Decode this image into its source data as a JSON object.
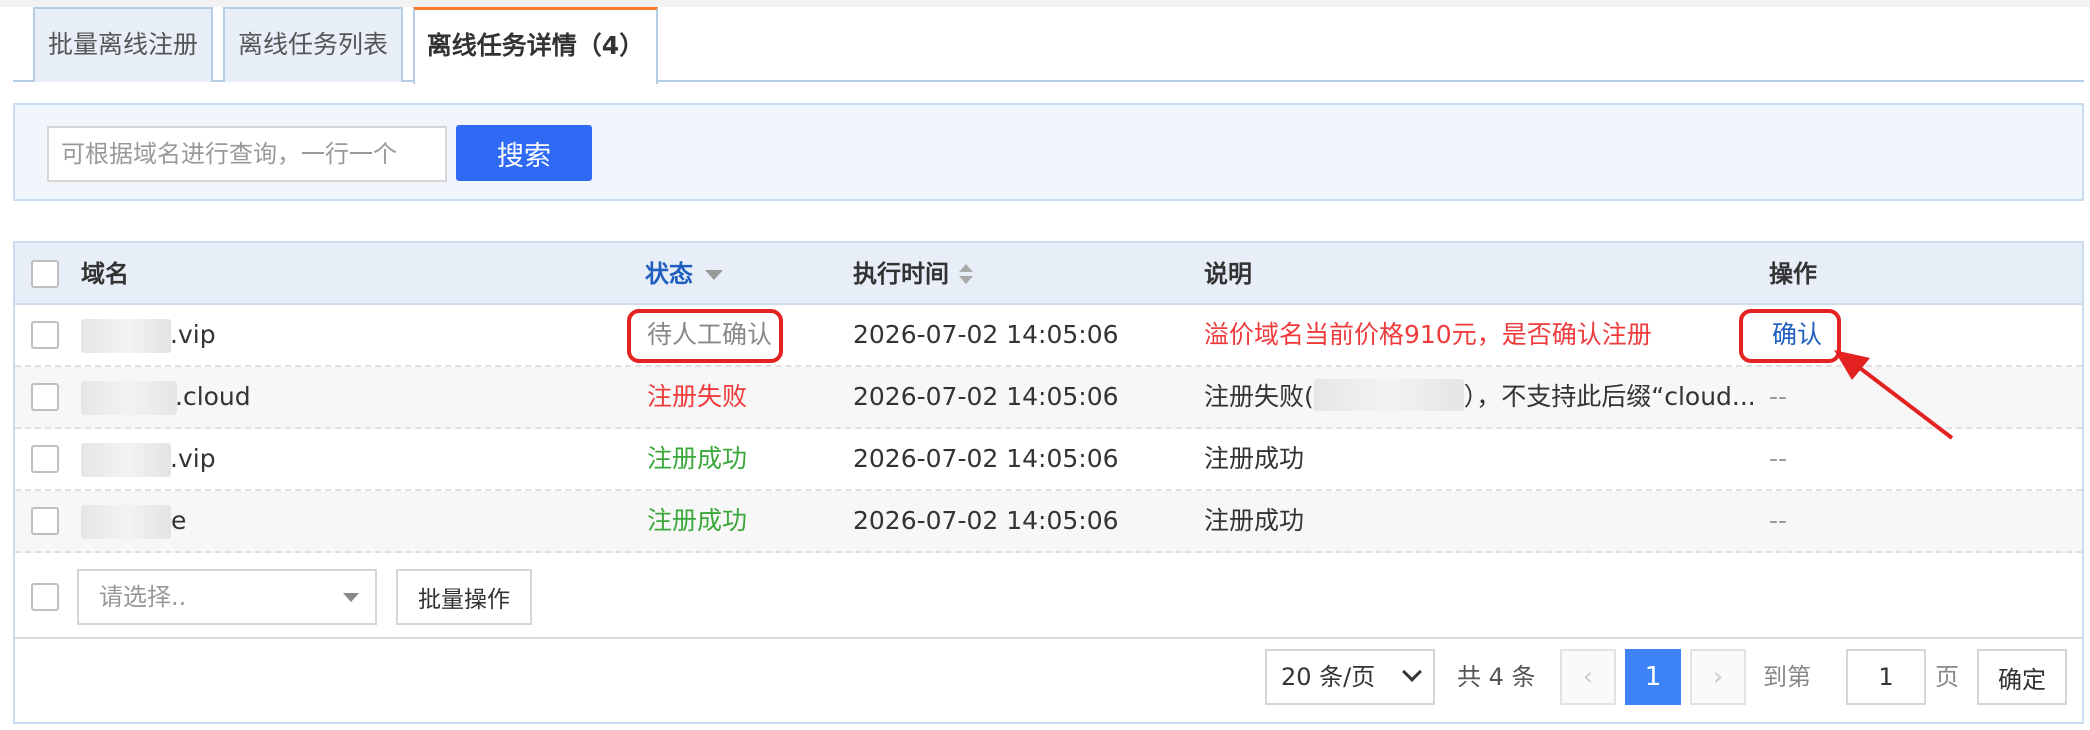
{
  "tabs": [
    {
      "label": "批量离线注册"
    },
    {
      "label": "离线任务列表"
    },
    {
      "label": "离线任务详情（4）"
    }
  ],
  "search": {
    "placeholder": "可根据域名进行查询，一行一个",
    "button_label": "搜索"
  },
  "table": {
    "columns": {
      "domain": "域名",
      "status": "状态",
      "exec_time": "执行时间",
      "description": "说明",
      "action": "操作"
    },
    "rows": [
      {
        "domain_suffix": ".vip",
        "status": "待人工确认",
        "status_color": "#888888",
        "time": "2026-07-02 14:05:06",
        "description": "溢价域名当前价格910元，是否确认注册",
        "description_color": "#ef3b3b",
        "action": "确认"
      },
      {
        "domain_suffix": ".cloud",
        "status": "注册失败",
        "status_color": "#ef3b3b",
        "time": "2026-07-02 14:05:06",
        "description_prefix": "注册失败(",
        "description": "），不支持此后缀“cloud...",
        "action": "--"
      },
      {
        "domain_suffix": ".vip",
        "status": "注册成功",
        "status_color": "#3aa83a",
        "time": "2026-07-02 14:05:06",
        "description": "注册成功",
        "action": "--"
      },
      {
        "domain_suffix": "e",
        "status": "注册成功",
        "status_color": "#3aa83a",
        "time": "2026-07-02 14:05:06",
        "description": "注册成功",
        "action": "--"
      }
    ]
  },
  "footer": {
    "select_placeholder": "请选择..",
    "batch_label": "批量操作"
  },
  "pagination": {
    "page_size": "20 条/页",
    "total": "共 4 条",
    "prev": "‹",
    "current": "1",
    "next": "›",
    "goto_prefix": "到第",
    "goto_value": "1",
    "goto_suffix": "页",
    "confirm_label": "确定"
  },
  "colors": {
    "primary": "#2f6af5",
    "highlight": "#e52222",
    "active_tab_accent": "#ff7a2b"
  }
}
